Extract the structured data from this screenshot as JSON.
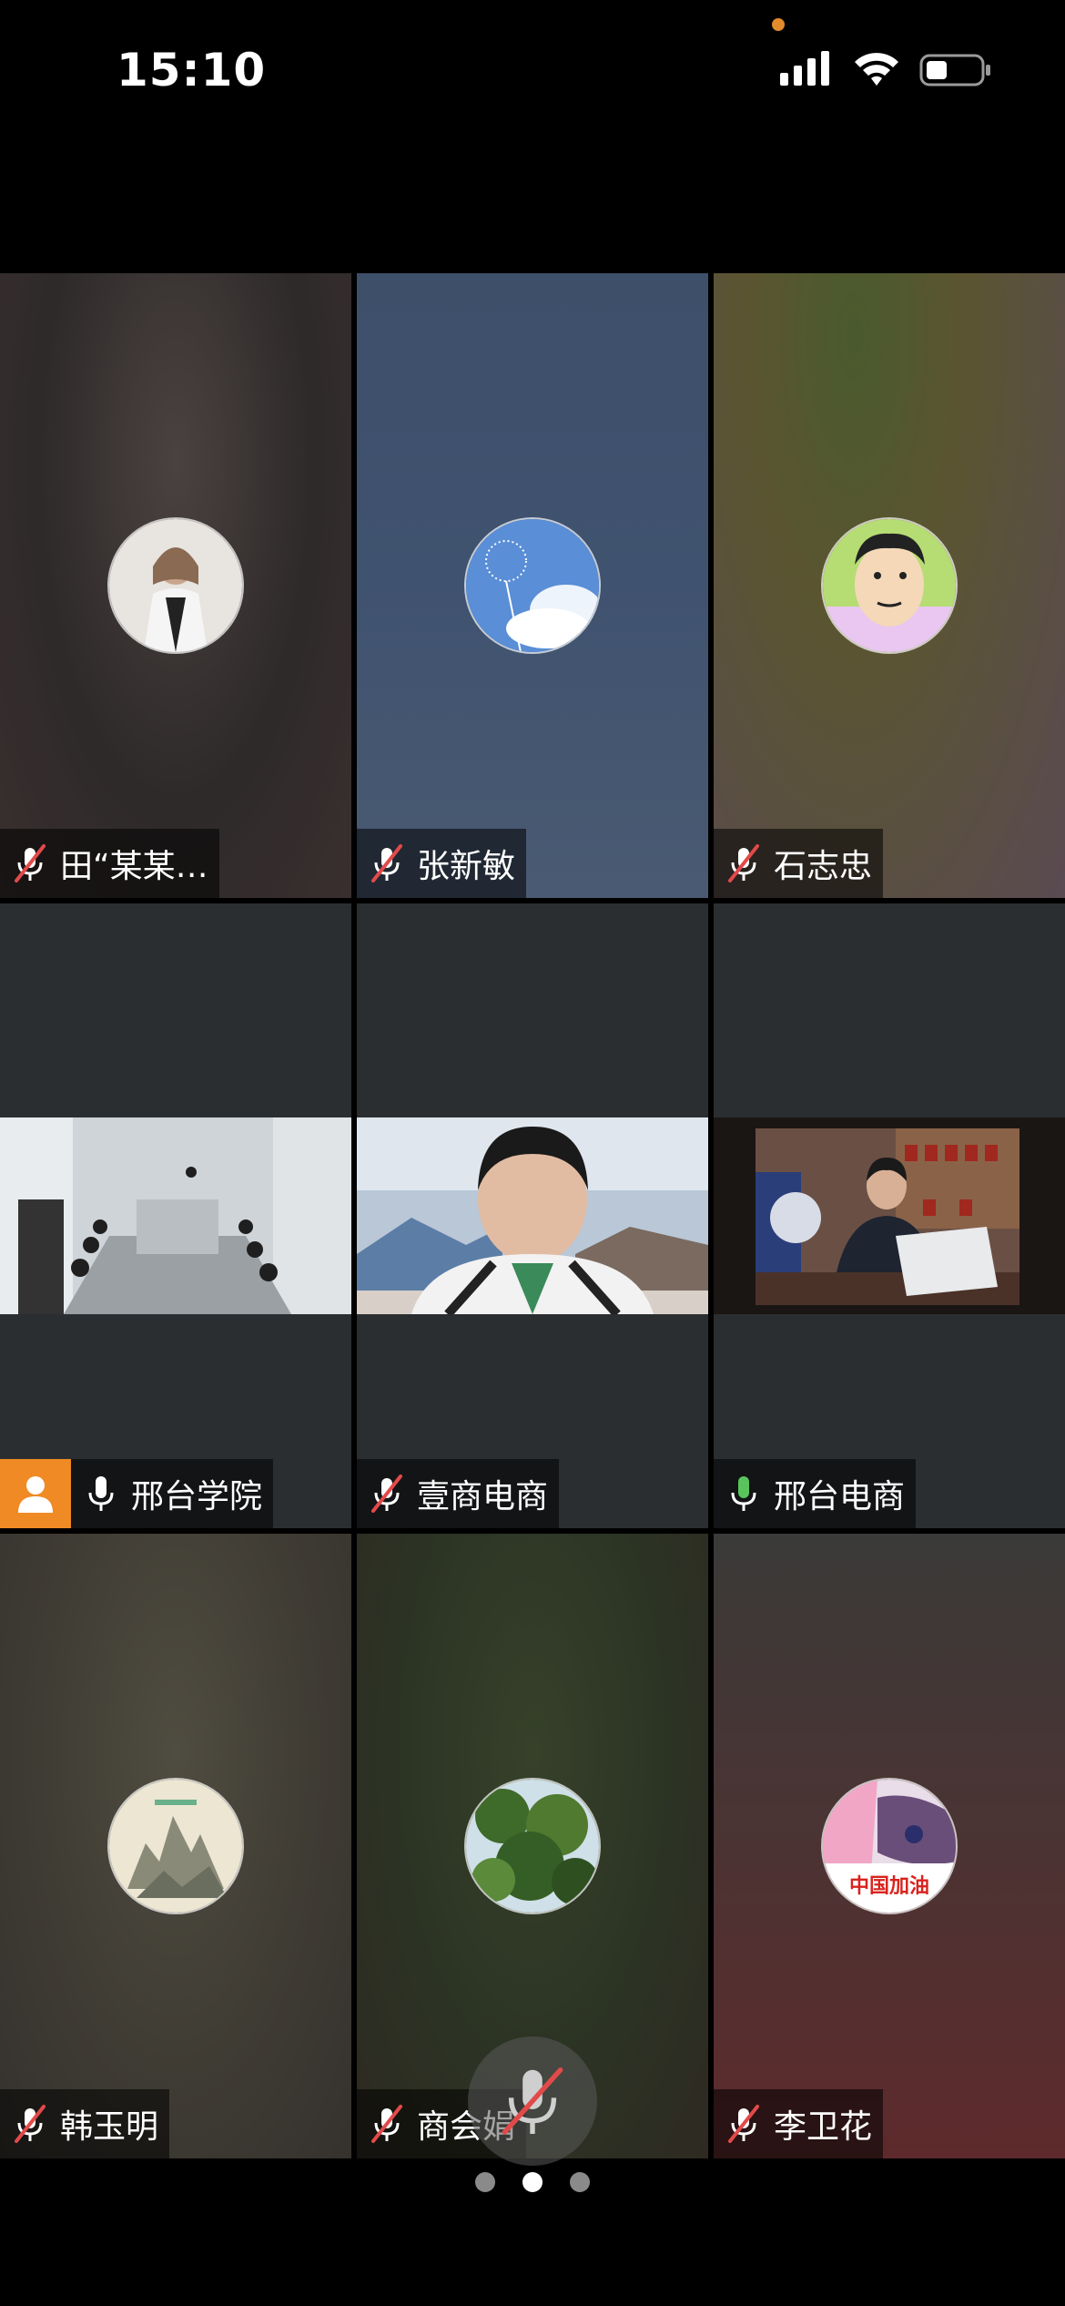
{
  "status_bar": {
    "time": "15:10",
    "icons": [
      "signal-icon",
      "wifi-icon",
      "battery-icon"
    ],
    "recording_dot_color": "#e38a2c"
  },
  "participants": [
    {
      "name": "田“某某…",
      "muted": true
    },
    {
      "name": "张新敏",
      "muted": true
    },
    {
      "name": "石志忠",
      "muted": true
    },
    {
      "name": "邢台学院",
      "muted": false,
      "host": true,
      "video": true
    },
    {
      "name": "壹商电商",
      "muted": true,
      "video": true
    },
    {
      "name": "邢台电商",
      "muted": false,
      "speaking": true,
      "video": true
    },
    {
      "name": "韩玉明",
      "muted": true
    },
    {
      "name": "商会娟",
      "muted": true
    },
    {
      "name": "李卫花",
      "muted": true,
      "avatar_text": "中国加油"
    }
  ],
  "pager": {
    "pages": 3,
    "current": 2
  },
  "colors": {
    "active_border": "#58c35a",
    "host_badge": "#f08a24",
    "mic_off": "#e24a4a"
  }
}
